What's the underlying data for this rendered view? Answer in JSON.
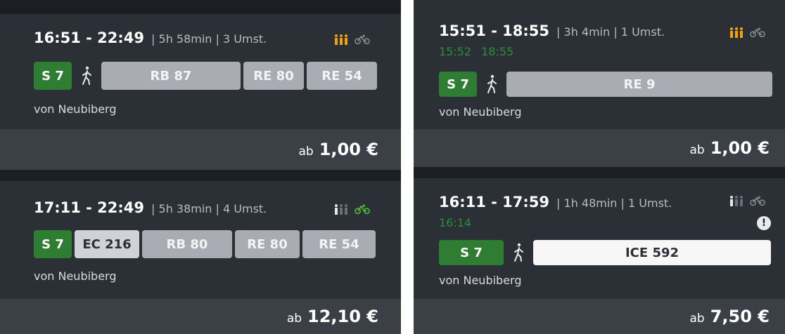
{
  "connections": [
    {
      "time_range": "16:51 - 22:49",
      "meta": "| 5h 58min | 3 Umst.",
      "occupancy_icon": "occupancy-high-icon",
      "bike_icon": "bike-icon",
      "legs": [
        "S 7",
        "RB 87",
        "RE 80",
        "RE 54"
      ],
      "origin": "von Neubiberg",
      "price_prefix": "ab",
      "price": "1,00 €"
    },
    {
      "time_range": "17:11 - 22:49",
      "meta": "| 5h 38min | 4 Umst.",
      "occupancy_icon": "occupancy-low-icon",
      "bike_icon": "bike-available-icon",
      "legs": [
        "S 7",
        "EC 216",
        "RB 80",
        "RE 80",
        "RE 54"
      ],
      "origin": "von Neubiberg",
      "price_prefix": "ab",
      "price": "12,10 €"
    },
    {
      "time_range": "15:51 - 18:55",
      "meta": "| 3h 4min | 1 Umst.",
      "actual_departure": "15:52",
      "actual_arrival": "18:55",
      "occupancy_icon": "occupancy-high-icon",
      "bike_icon": "bike-icon",
      "legs": [
        "S 7",
        "RE 9"
      ],
      "origin": "von Neubiberg",
      "price_prefix": "ab",
      "price": "1,00 €"
    },
    {
      "time_range": "16:11 - 17:59",
      "meta": "| 1h 48min | 1 Umst.",
      "actual_departure": "16:14",
      "occupancy_icon": "occupancy-low-icon",
      "bike_icon": "bike-icon",
      "warning": "!",
      "legs": [
        "S 7",
        "ICE 592"
      ],
      "origin": "von Neubiberg",
      "price_prefix": "ab",
      "price": "7,50 €"
    }
  ],
  "colors": {
    "background": "#1b1e23",
    "card": "#2b2f36",
    "footer": "#3b4047",
    "s_bahn_green": "#2e7d32",
    "realtime_green": "#2e8b3a",
    "occupancy_orange": "#f0a30a",
    "leg_gray": "#a9adb3"
  }
}
